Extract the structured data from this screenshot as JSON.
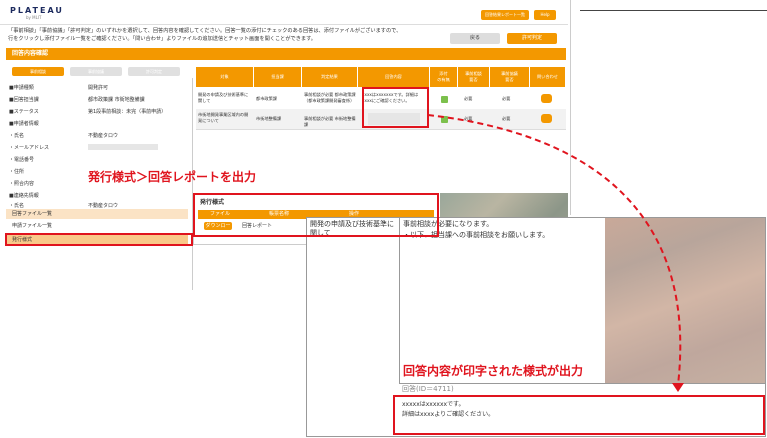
{
  "app": {
    "logo": "PLATEAU",
    "logo_sub": "by MLIT",
    "top_btn1": "回答結果レポート一覧",
    "top_btn2": "Help"
  },
  "instruction": {
    "line1": "「事前相談」「事前協議」「許可判定」のいずれかを選択して、回答内容を確認してください。回答一覧の添付にチェックのある回答は、添付ファイルがございますので、",
    "line2": "行をクリックし添付ファイル一覧をご確認ください。「問い合わせ」よりファイルの追加送信とチャット画面を開くことができます。"
  },
  "actions": {
    "back": "戻る",
    "confirm": "許可判定"
  },
  "section": {
    "title": "回答内容確認"
  },
  "left_tabs": [
    "事前相談",
    "事前協議",
    "許可判定"
  ],
  "left_fields": [
    {
      "label": "■申請種類",
      "value": "開発許可"
    },
    {
      "label": "■回答担当課",
      "value": "都市政策課 市街地整備課"
    },
    {
      "label": "■ステータス",
      "value": "第1段事前相談：未完（事前申請）"
    },
    {
      "label": "■申請者情報",
      "value": ""
    },
    {
      "label": "・氏名",
      "value": "不動産タロウ"
    },
    {
      "label": "・メールアドレス",
      "value": ""
    },
    {
      "label": "・電話番号",
      "value": ""
    },
    {
      "label": "・住所",
      "value": ""
    },
    {
      "label": "・照合内容",
      "value": ""
    },
    {
      "label": "■連絡先情報",
      "value": ""
    },
    {
      "label": "・氏名",
      "value": "不動産タロウ"
    }
  ],
  "left_menu": {
    "item1": "回答ファイル一覧",
    "item2": "申請ファイル一覧",
    "item3": "発行様式"
  },
  "right_table": {
    "headers": [
      "対象",
      "担当課",
      "判定結果",
      "回答内容",
      "添付\nの有無",
      "事前相談\n要否",
      "事前協議\n要否",
      "問い合わせ"
    ],
    "rows": [
      {
        "target": "開発の申請及び技術基準に関して",
        "dept": "都市政策課",
        "result": "事前相談が必要 都市政策課（都市政策課開発審査係）",
        "answer": "xxxxはxxxxxxxです。詳細はxxxxにご確認ください。",
        "pre": "必要",
        "pre2": "必要"
      },
      {
        "target": "市街地開発事業区域内の開発について",
        "dept": "市街地整備課",
        "result": "事前相談が必要 市街地整備課",
        "answer": "",
        "pre": "必要",
        "pre2": "必要"
      }
    ]
  },
  "doc_panel": {
    "title": "発行様式",
    "col1": "ファイル",
    "col2": "帳票名称",
    "col3": "操作",
    "btn": "ダウンロード",
    "name": "回答レポート"
  },
  "doc": {
    "left_text": "開発の申請及び技術基準に関して",
    "right_line1": "事前相談が必要になります。",
    "right_line2": "・以下、担当課への事前相談をお願いします。",
    "answer_id": "回答(ID＝4711)",
    "answer_line1": "xxxxxはxxxxxxです。",
    "answer_line2": "詳細はxxxxよりご確認ください。"
  },
  "annotations": {
    "label1": "発行様式＞回答レポートを出力",
    "label2": "回答内容が印字された様式が出力"
  },
  "colors": {
    "accent": "#f39800",
    "highlight": "#e0141e"
  }
}
